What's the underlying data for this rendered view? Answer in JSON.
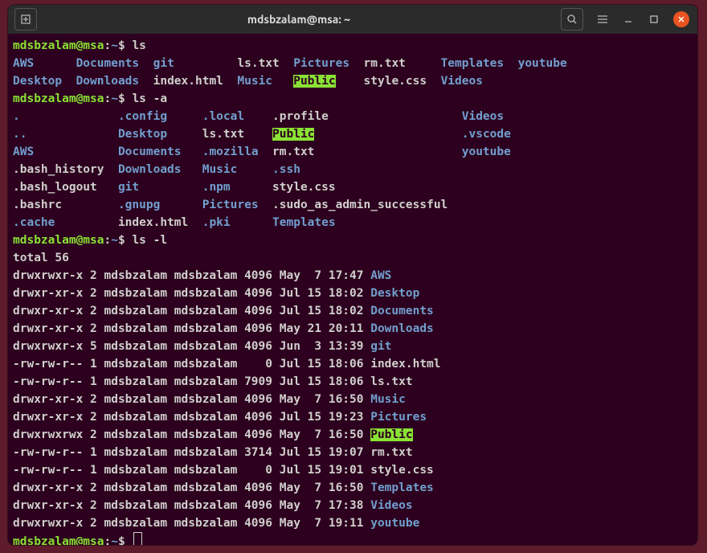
{
  "window": {
    "title": "mdsbzalam@msa: ~"
  },
  "prompt": {
    "user_host": "mdsbzalam@msa",
    "path": "~",
    "symbol": "$"
  },
  "commands": {
    "ls": "ls",
    "ls_a": "ls -a",
    "ls_l": "ls -l"
  },
  "ls_output_cols": [
    [
      {
        "t": "AWS",
        "c": "dir"
      },
      {
        "t": "Desktop",
        "c": "dir"
      }
    ],
    [
      {
        "t": "Documents",
        "c": "dir"
      },
      {
        "t": "Downloads",
        "c": "dir"
      }
    ],
    [
      {
        "t": "git",
        "c": "dir"
      },
      {
        "t": "index.html",
        "c": "plain"
      }
    ],
    [
      {
        "t": "ls.txt",
        "c": "plain"
      },
      {
        "t": "Music",
        "c": "dir"
      }
    ],
    [
      {
        "t": "Pictures",
        "c": "dir"
      },
      {
        "t": "Public",
        "c": "hl"
      }
    ],
    [
      {
        "t": "rm.txt",
        "c": "plain"
      },
      {
        "t": "style.css",
        "c": "plain"
      }
    ],
    [
      {
        "t": "Templates",
        "c": "dir"
      },
      {
        "t": "Videos",
        "c": "dir"
      }
    ],
    [
      {
        "t": "youtube",
        "c": "dir"
      },
      {
        "t": "",
        "c": "plain"
      }
    ]
  ],
  "ls_a_cols": [
    [
      {
        "t": ".",
        "c": "dir"
      },
      {
        "t": "..",
        "c": "dir"
      },
      {
        "t": "AWS",
        "c": "dir"
      },
      {
        "t": ".bash_history",
        "c": "plain"
      },
      {
        "t": ".bash_logout",
        "c": "plain"
      },
      {
        "t": ".bashrc",
        "c": "plain"
      },
      {
        "t": ".cache",
        "c": "dir"
      }
    ],
    [
      {
        "t": ".config",
        "c": "dir"
      },
      {
        "t": "Desktop",
        "c": "dir"
      },
      {
        "t": "Documents",
        "c": "dir"
      },
      {
        "t": "Downloads",
        "c": "dir"
      },
      {
        "t": "git",
        "c": "dir"
      },
      {
        "t": ".gnupg",
        "c": "dir"
      },
      {
        "t": "index.html",
        "c": "plain"
      }
    ],
    [
      {
        "t": ".local",
        "c": "dir"
      },
      {
        "t": "ls.txt",
        "c": "plain"
      },
      {
        "t": ".mozilla",
        "c": "dir"
      },
      {
        "t": "Music",
        "c": "dir"
      },
      {
        "t": ".npm",
        "c": "dir"
      },
      {
        "t": "Pictures",
        "c": "dir"
      },
      {
        "t": ".pki",
        "c": "dir"
      }
    ],
    [
      {
        "t": ".profile",
        "c": "plain"
      },
      {
        "t": "Public",
        "c": "hl"
      },
      {
        "t": "rm.txt",
        "c": "plain"
      },
      {
        "t": ".ssh",
        "c": "dir"
      },
      {
        "t": "style.css",
        "c": "plain"
      },
      {
        "t": ".sudo_as_admin_successful",
        "c": "plain"
      },
      {
        "t": "Templates",
        "c": "dir"
      }
    ],
    [
      {
        "t": "Videos",
        "c": "dir"
      },
      {
        "t": ".vscode",
        "c": "dir"
      },
      {
        "t": "youtube",
        "c": "dir"
      },
      {
        "t": "",
        "c": "plain"
      },
      {
        "t": "",
        "c": "plain"
      },
      {
        "t": "",
        "c": "plain"
      },
      {
        "t": "",
        "c": "plain"
      }
    ]
  ],
  "ls_l_total": "total 56",
  "ls_l_rows": [
    {
      "perm": "drwxrwxr-x",
      "n": "2",
      "u": "mdsbzalam",
      "g": "mdsbzalam",
      "sz": "4096",
      "mo": "May",
      "d": " 7",
      "tm": "17:47",
      "name": "AWS",
      "c": "dir"
    },
    {
      "perm": "drwxr-xr-x",
      "n": "2",
      "u": "mdsbzalam",
      "g": "mdsbzalam",
      "sz": "4096",
      "mo": "Jul",
      "d": "15",
      "tm": "18:02",
      "name": "Desktop",
      "c": "dir"
    },
    {
      "perm": "drwxr-xr-x",
      "n": "2",
      "u": "mdsbzalam",
      "g": "mdsbzalam",
      "sz": "4096",
      "mo": "Jul",
      "d": "15",
      "tm": "18:02",
      "name": "Documents",
      "c": "dir"
    },
    {
      "perm": "drwxr-xr-x",
      "n": "2",
      "u": "mdsbzalam",
      "g": "mdsbzalam",
      "sz": "4096",
      "mo": "May",
      "d": "21",
      "tm": "20:11",
      "name": "Downloads",
      "c": "dir"
    },
    {
      "perm": "drwxrwxr-x",
      "n": "5",
      "u": "mdsbzalam",
      "g": "mdsbzalam",
      "sz": "4096",
      "mo": "Jun",
      "d": " 3",
      "tm": "13:39",
      "name": "git",
      "c": "dir"
    },
    {
      "perm": "-rw-rw-r--",
      "n": "1",
      "u": "mdsbzalam",
      "g": "mdsbzalam",
      "sz": "   0",
      "mo": "Jul",
      "d": "15",
      "tm": "18:06",
      "name": "index.html",
      "c": "plain"
    },
    {
      "perm": "-rw-rw-r--",
      "n": "1",
      "u": "mdsbzalam",
      "g": "mdsbzalam",
      "sz": "7909",
      "mo": "Jul",
      "d": "15",
      "tm": "18:06",
      "name": "ls.txt",
      "c": "plain"
    },
    {
      "perm": "drwxr-xr-x",
      "n": "2",
      "u": "mdsbzalam",
      "g": "mdsbzalam",
      "sz": "4096",
      "mo": "May",
      "d": " 7",
      "tm": "16:50",
      "name": "Music",
      "c": "dir"
    },
    {
      "perm": "drwxr-xr-x",
      "n": "2",
      "u": "mdsbzalam",
      "g": "mdsbzalam",
      "sz": "4096",
      "mo": "Jul",
      "d": "15",
      "tm": "19:23",
      "name": "Pictures",
      "c": "dir"
    },
    {
      "perm": "drwxrwxrwx",
      "n": "2",
      "u": "mdsbzalam",
      "g": "mdsbzalam",
      "sz": "4096",
      "mo": "May",
      "d": " 7",
      "tm": "16:50",
      "name": "Public",
      "c": "hl"
    },
    {
      "perm": "-rw-rw-r--",
      "n": "1",
      "u": "mdsbzalam",
      "g": "mdsbzalam",
      "sz": "3714",
      "mo": "Jul",
      "d": "15",
      "tm": "19:07",
      "name": "rm.txt",
      "c": "plain"
    },
    {
      "perm": "-rw-rw-r--",
      "n": "1",
      "u": "mdsbzalam",
      "g": "mdsbzalam",
      "sz": "   0",
      "mo": "Jul",
      "d": "15",
      "tm": "19:01",
      "name": "style.css",
      "c": "plain"
    },
    {
      "perm": "drwxr-xr-x",
      "n": "2",
      "u": "mdsbzalam",
      "g": "mdsbzalam",
      "sz": "4096",
      "mo": "May",
      "d": " 7",
      "tm": "16:50",
      "name": "Templates",
      "c": "dir"
    },
    {
      "perm": "drwxr-xr-x",
      "n": "2",
      "u": "mdsbzalam",
      "g": "mdsbzalam",
      "sz": "4096",
      "mo": "May",
      "d": " 7",
      "tm": "17:38",
      "name": "Videos",
      "c": "dir"
    },
    {
      "perm": "drwxrwxr-x",
      "n": "2",
      "u": "mdsbzalam",
      "g": "mdsbzalam",
      "sz": "4096",
      "mo": "May",
      "d": " 7",
      "tm": "19:11",
      "name": "youtube",
      "c": "dir"
    }
  ]
}
